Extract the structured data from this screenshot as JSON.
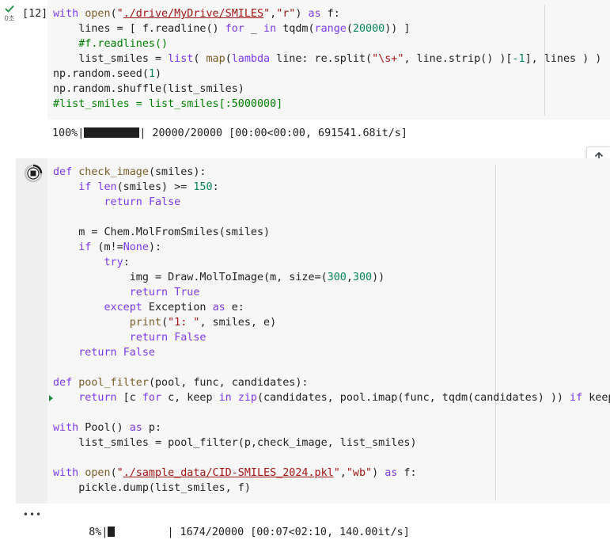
{
  "cell1": {
    "exec_count": "[12]",
    "exec_time": "0초",
    "code_lines": [
      "with open(\"./drive/MyDrive/SMILES\",\"r\") as f:",
      "    lines = [ f.readline() for _ in tqdm(range(20000)) ]",
      "    #f.readlines()",
      "    list_smiles = list( map(lambda line: re.split(\"\\s+\", line.strip() )[-1], lines ) )",
      "np.random.seed(1)",
      "np.random.shuffle(list_smiles)",
      "#list_smiles = list_smiles[:5000000]"
    ],
    "output": {
      "percent": "100%|",
      "progress_fraction": 1.0,
      "stats": "| 20000/20000 [00:00<00:00, 691541.68it/s]"
    }
  },
  "cell2": {
    "code_lines": [
      "def check_image(smiles):",
      "    if len(smiles) >= 150:",
      "        return False",
      "",
      "    m = Chem.MolFromSmiles(smiles)",
      "    if (m!=None):",
      "        try:",
      "            img = Draw.MolToImage(m, size=(300,300))",
      "            return True",
      "        except Exception as e:",
      "            print(\"1: \", smiles, e)",
      "            return False",
      "    return False",
      "",
      "def pool_filter(pool, func, candidates):",
      "    return [c for c, keep in zip(candidates, pool.imap(func, tqdm(candidates) )) if keep]",
      "",
      "with Pool() as p:",
      "    list_smiles = pool_filter(p,check_image, list_smiles)",
      "",
      "with open(\"./sample_data/CID-SMILES_2024.pkl\",\"wb\") as f:",
      "    pickle.dump(list_smiles, f)"
    ],
    "output": {
      "more": "•••",
      "percent": "8%|",
      "progress_fraction": 0.08,
      "stats": "| 1674/20000 [00:07<02:10, 140.00it/s]"
    }
  },
  "icons": {
    "check": "check-icon",
    "stop": "stop-icon",
    "arrow_up": "arrow-up-icon",
    "more": "more-icon"
  },
  "colors": {
    "cell_bg": "#f7f7f7",
    "keyword": "#7c3aed",
    "string": "#a31515",
    "number": "#098658",
    "comment": "#008000",
    "check_green": "#1e8e3e"
  }
}
